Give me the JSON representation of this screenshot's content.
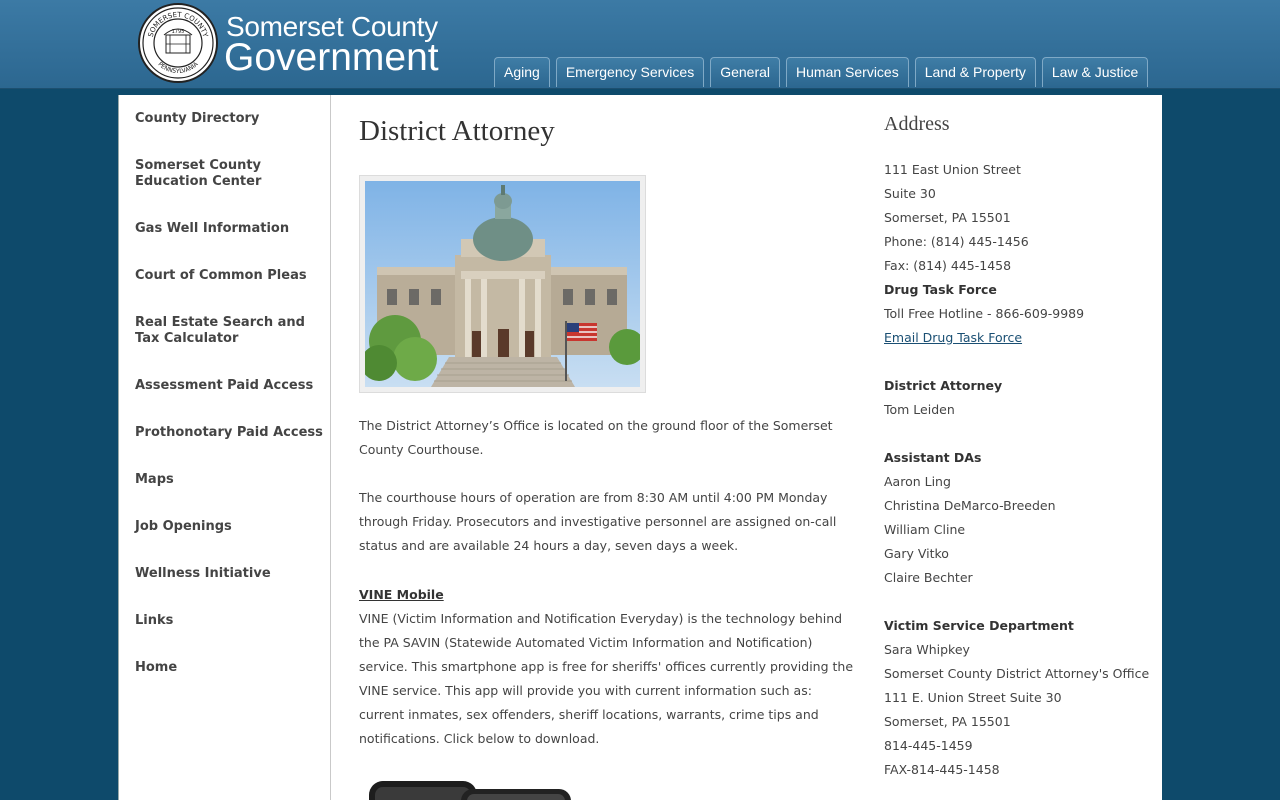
{
  "header": {
    "brand_line1": "Somerset County",
    "brand_line2": "Government",
    "seal_text_top": "SOMERSET COUNTY",
    "seal_text_bottom": "PENNSYLVANIA",
    "seal_year": "1795"
  },
  "nav": {
    "tabs": [
      {
        "label": "Aging"
      },
      {
        "label": "Emergency Services"
      },
      {
        "label": "General"
      },
      {
        "label": "Human Services"
      },
      {
        "label": "Land & Property"
      },
      {
        "label": "Law & Justice"
      }
    ]
  },
  "sidebar": {
    "items": [
      {
        "label": "County Directory"
      },
      {
        "label": "Somerset County Education Center"
      },
      {
        "label": "Gas Well Information"
      },
      {
        "label": "Court of Common Pleas"
      },
      {
        "label": "Real Estate Search and Tax Calculator"
      },
      {
        "label": "Assessment Paid Access"
      },
      {
        "label": "Prothonotary Paid Access"
      },
      {
        "label": "Maps"
      },
      {
        "label": "Job Openings"
      },
      {
        "label": "Wellness Initiative"
      },
      {
        "label": "Links"
      },
      {
        "label": "Home"
      }
    ]
  },
  "main": {
    "title": "District Attorney",
    "para1": "The District Attorney’s Office is located on the ground floor of the Somerset County Courthouse.",
    "para2": "The courthouse hours of operation are from 8:30 AM until 4:00 PM Monday through Friday. Prosecutors and investigative personnel are assigned on-call status and are available 24 hours a day, seven days a week.",
    "vine_link": "VINE Mobile",
    "para3": "VINE (Victim Information and Notification Everyday) is the technology behind the PA SAVIN (Statewide Automated Victim Information and Notification) service. This smartphone app is free for sheriffs' offices currently providing the VINE service. This app will provide you with current information such as: current inmates, sex offenders, sheriff locations, warrants, crime tips and notifications. Click below to download."
  },
  "right": {
    "heading": "Address",
    "address": [
      "111 East Union Street",
      "Suite 30",
      "Somerset, PA 15501",
      "Phone: (814) 445-1456",
      "Fax: (814) 445-1458"
    ],
    "drug_task_force_heading": "Drug Task Force",
    "drug_hotline": "Toll Free Hotline - 866-609-9989",
    "drug_email_link": "Email Drug Task Force",
    "da_heading": "District Attorney",
    "da_name": "Tom Leiden",
    "assistant_heading": "Assistant DAs",
    "assistants": [
      "Aaron Ling",
      "Christina DeMarco-Breeden",
      "William Cline",
      "Gary Vitko",
      "Claire Bechter"
    ],
    "victim_heading": "Victim Service Department",
    "victim_lines": [
      "Sara Whipkey",
      "Somerset County District Attorney's Office",
      "111 E. Union Street Suite 30",
      "Somerset, PA 15501",
      "814-445-1459",
      "FAX-814-445-1458"
    ]
  },
  "colors": {
    "page_bg": "#0e4a6b",
    "header_bg": "#2c6790",
    "link": "#1a4f73"
  }
}
